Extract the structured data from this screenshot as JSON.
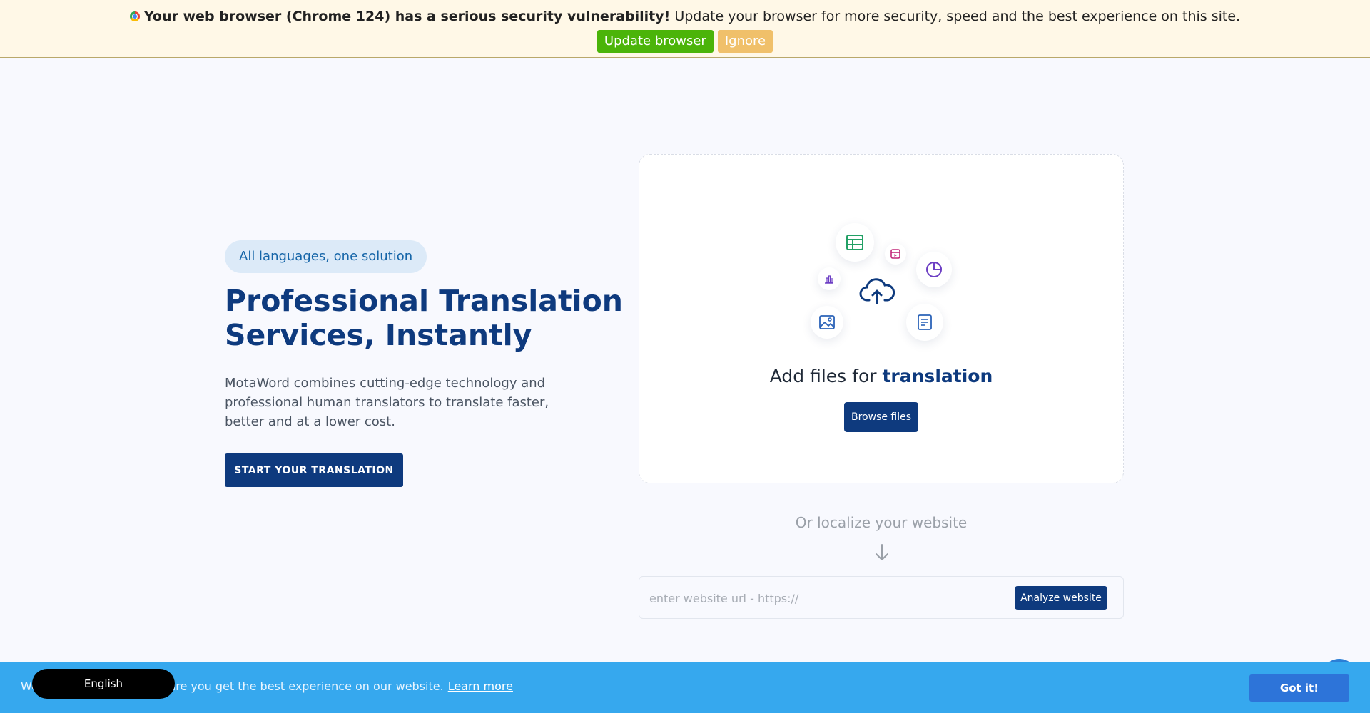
{
  "banner": {
    "bold_text": "Your web browser (Chrome 124) has a serious security vulnerability!",
    "text": "Update your browser for more security, speed and the best experience on this site.",
    "update_label": "Update browser",
    "ignore_label": "Ignore"
  },
  "hero": {
    "pill": "All languages, one solution",
    "title_line1": "Professional Translation",
    "title_line2": "Services, Instantly",
    "description": "MotaWord combines cutting-edge technology and professional human translators to translate faster, better and at a lower cost.",
    "cta_label": "START YOUR TRANSLATION"
  },
  "upload": {
    "title_prefix": "Add files for",
    "title_accent": "translation",
    "browse_label": "Browse files",
    "icons": [
      "spreadsheet-icon",
      "video-icon",
      "pie-chart-icon",
      "bar-chart-icon",
      "cloud-upload-icon",
      "image-icon",
      "document-icon"
    ]
  },
  "localize": {
    "label": "Or localize your website",
    "url_placeholder": "enter website url - https://",
    "analyze_label": "Analyze website"
  },
  "cookie": {
    "text": "We use cookies to make sure you get the best experience on our website.",
    "learn_more": "Learn more",
    "got_it": "Got it!"
  },
  "language": {
    "current": "English"
  },
  "colors": {
    "brand_navy": "#0e3a7e",
    "update_green": "#4bb409",
    "ignore_amber": "#f0c06a",
    "cookie_blue": "#36a8ee"
  }
}
